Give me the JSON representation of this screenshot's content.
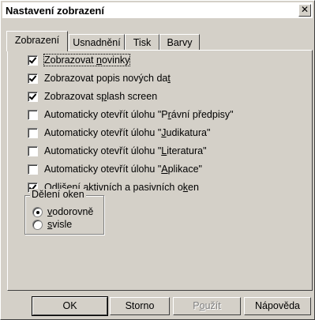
{
  "dialog": {
    "title": "Nastavení zobrazení",
    "close_symbol": "✕"
  },
  "tabs": [
    {
      "label": "Zobrazení",
      "active": true
    },
    {
      "label": "Usnadnění",
      "active": false
    },
    {
      "label": "Tisk",
      "active": false
    },
    {
      "label": "Barvy",
      "active": false
    }
  ],
  "options": [
    {
      "pre": "Zobrazovat ",
      "key": "n",
      "post": "ovinky",
      "checked": true
    },
    {
      "pre": "Zobrazovat popis nových da",
      "key": "t",
      "post": "",
      "checked": true
    },
    {
      "pre": "Zobrazovat s",
      "key": "p",
      "post": "lash screen",
      "checked": true
    },
    {
      "pre": "Automaticky otevřít úlohu \"P",
      "key": "r",
      "post": "ávní předpisy\"",
      "checked": false
    },
    {
      "pre": "Automaticky otevřít úlohu \"",
      "key": "J",
      "post": "udikatura\"",
      "checked": false
    },
    {
      "pre": "Automaticky otevřít úlohu \"",
      "key": "L",
      "post": "iteratura\"",
      "checked": false
    },
    {
      "pre": "Automaticky otevřít úlohu \"",
      "key": "A",
      "post": "plikace\"",
      "checked": false
    },
    {
      "pre": "Odlišení aktivních a pasivních o",
      "key": "k",
      "post": "en",
      "checked": true
    }
  ],
  "window_split": {
    "legend": "Dělení oken",
    "options": [
      {
        "pre": "",
        "key": "v",
        "post": "odorovně",
        "selected": true
      },
      {
        "pre": "",
        "key": "s",
        "post": "visle",
        "selected": false
      }
    ]
  },
  "buttons": {
    "ok": "OK",
    "cancel": "Storno",
    "apply_pre": "P",
    "apply_key": "o",
    "apply_post": "užít",
    "help": "Nápověda"
  }
}
